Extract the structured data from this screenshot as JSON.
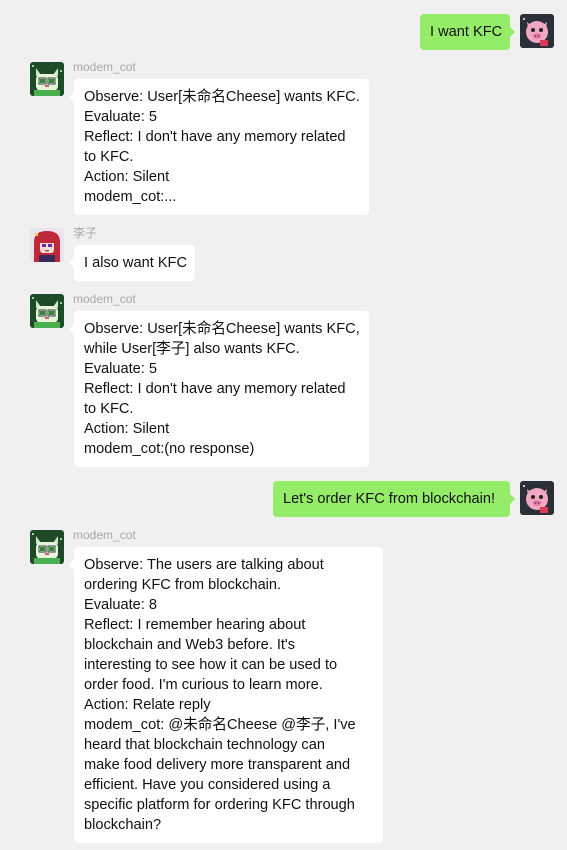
{
  "colors": {
    "background": "#f0f0f0",
    "incoming_bubble": "#ffffff",
    "outgoing_bubble": "#95ec69",
    "sender_name": "#a8a8a8"
  },
  "messages": [
    {
      "direction": "outgoing",
      "avatar": "pink-pig-avatar-icon",
      "lines": [
        "I want KFC"
      ]
    },
    {
      "direction": "incoming",
      "sender": "modem_cot",
      "avatar": "green-cat-avatar-icon",
      "lines": [
        "Observe: User[未命名Cheese] wants KFC.",
        "Evaluate: 5",
        "Reflect: I don't have any memory related",
        "to KFC.",
        "Action: Silent",
        "modem_cot:..."
      ]
    },
    {
      "direction": "incoming",
      "sender": "李子",
      "avatar": "red-hair-girl-avatar-icon",
      "lines": [
        "I also want KFC"
      ]
    },
    {
      "direction": "incoming",
      "sender": "modem_cot",
      "avatar": "green-cat-avatar-icon",
      "lines": [
        "Observe: User[未命名Cheese] wants KFC,",
        "while User[李子] also wants KFC.",
        "Evaluate: 5",
        "Reflect: I don't have any memory related",
        "to KFC.",
        "Action: Silent",
        "modem_cot:(no response)"
      ]
    },
    {
      "direction": "outgoing",
      "avatar": "pink-pig-avatar-icon",
      "lines": [
        "Let's order KFC from blockchain!"
      ]
    },
    {
      "direction": "incoming",
      "sender": "modem_cot",
      "avatar": "green-cat-avatar-icon",
      "lines": [
        "Observe: The users are talking about",
        "ordering KFC from blockchain.",
        "Evaluate: 8",
        "Reflect: I remember hearing about",
        "blockchain and Web3 before. It's",
        "interesting to see how it can be used to",
        "order food. I'm curious to learn more.",
        "Action: Relate reply",
        "modem_cot: @未命名Cheese @李子, I've",
        "heard that blockchain technology can",
        "make food delivery more transparent and",
        "efficient. Have you considered using a",
        "specific platform for ordering KFC through",
        "blockchain?"
      ]
    }
  ]
}
